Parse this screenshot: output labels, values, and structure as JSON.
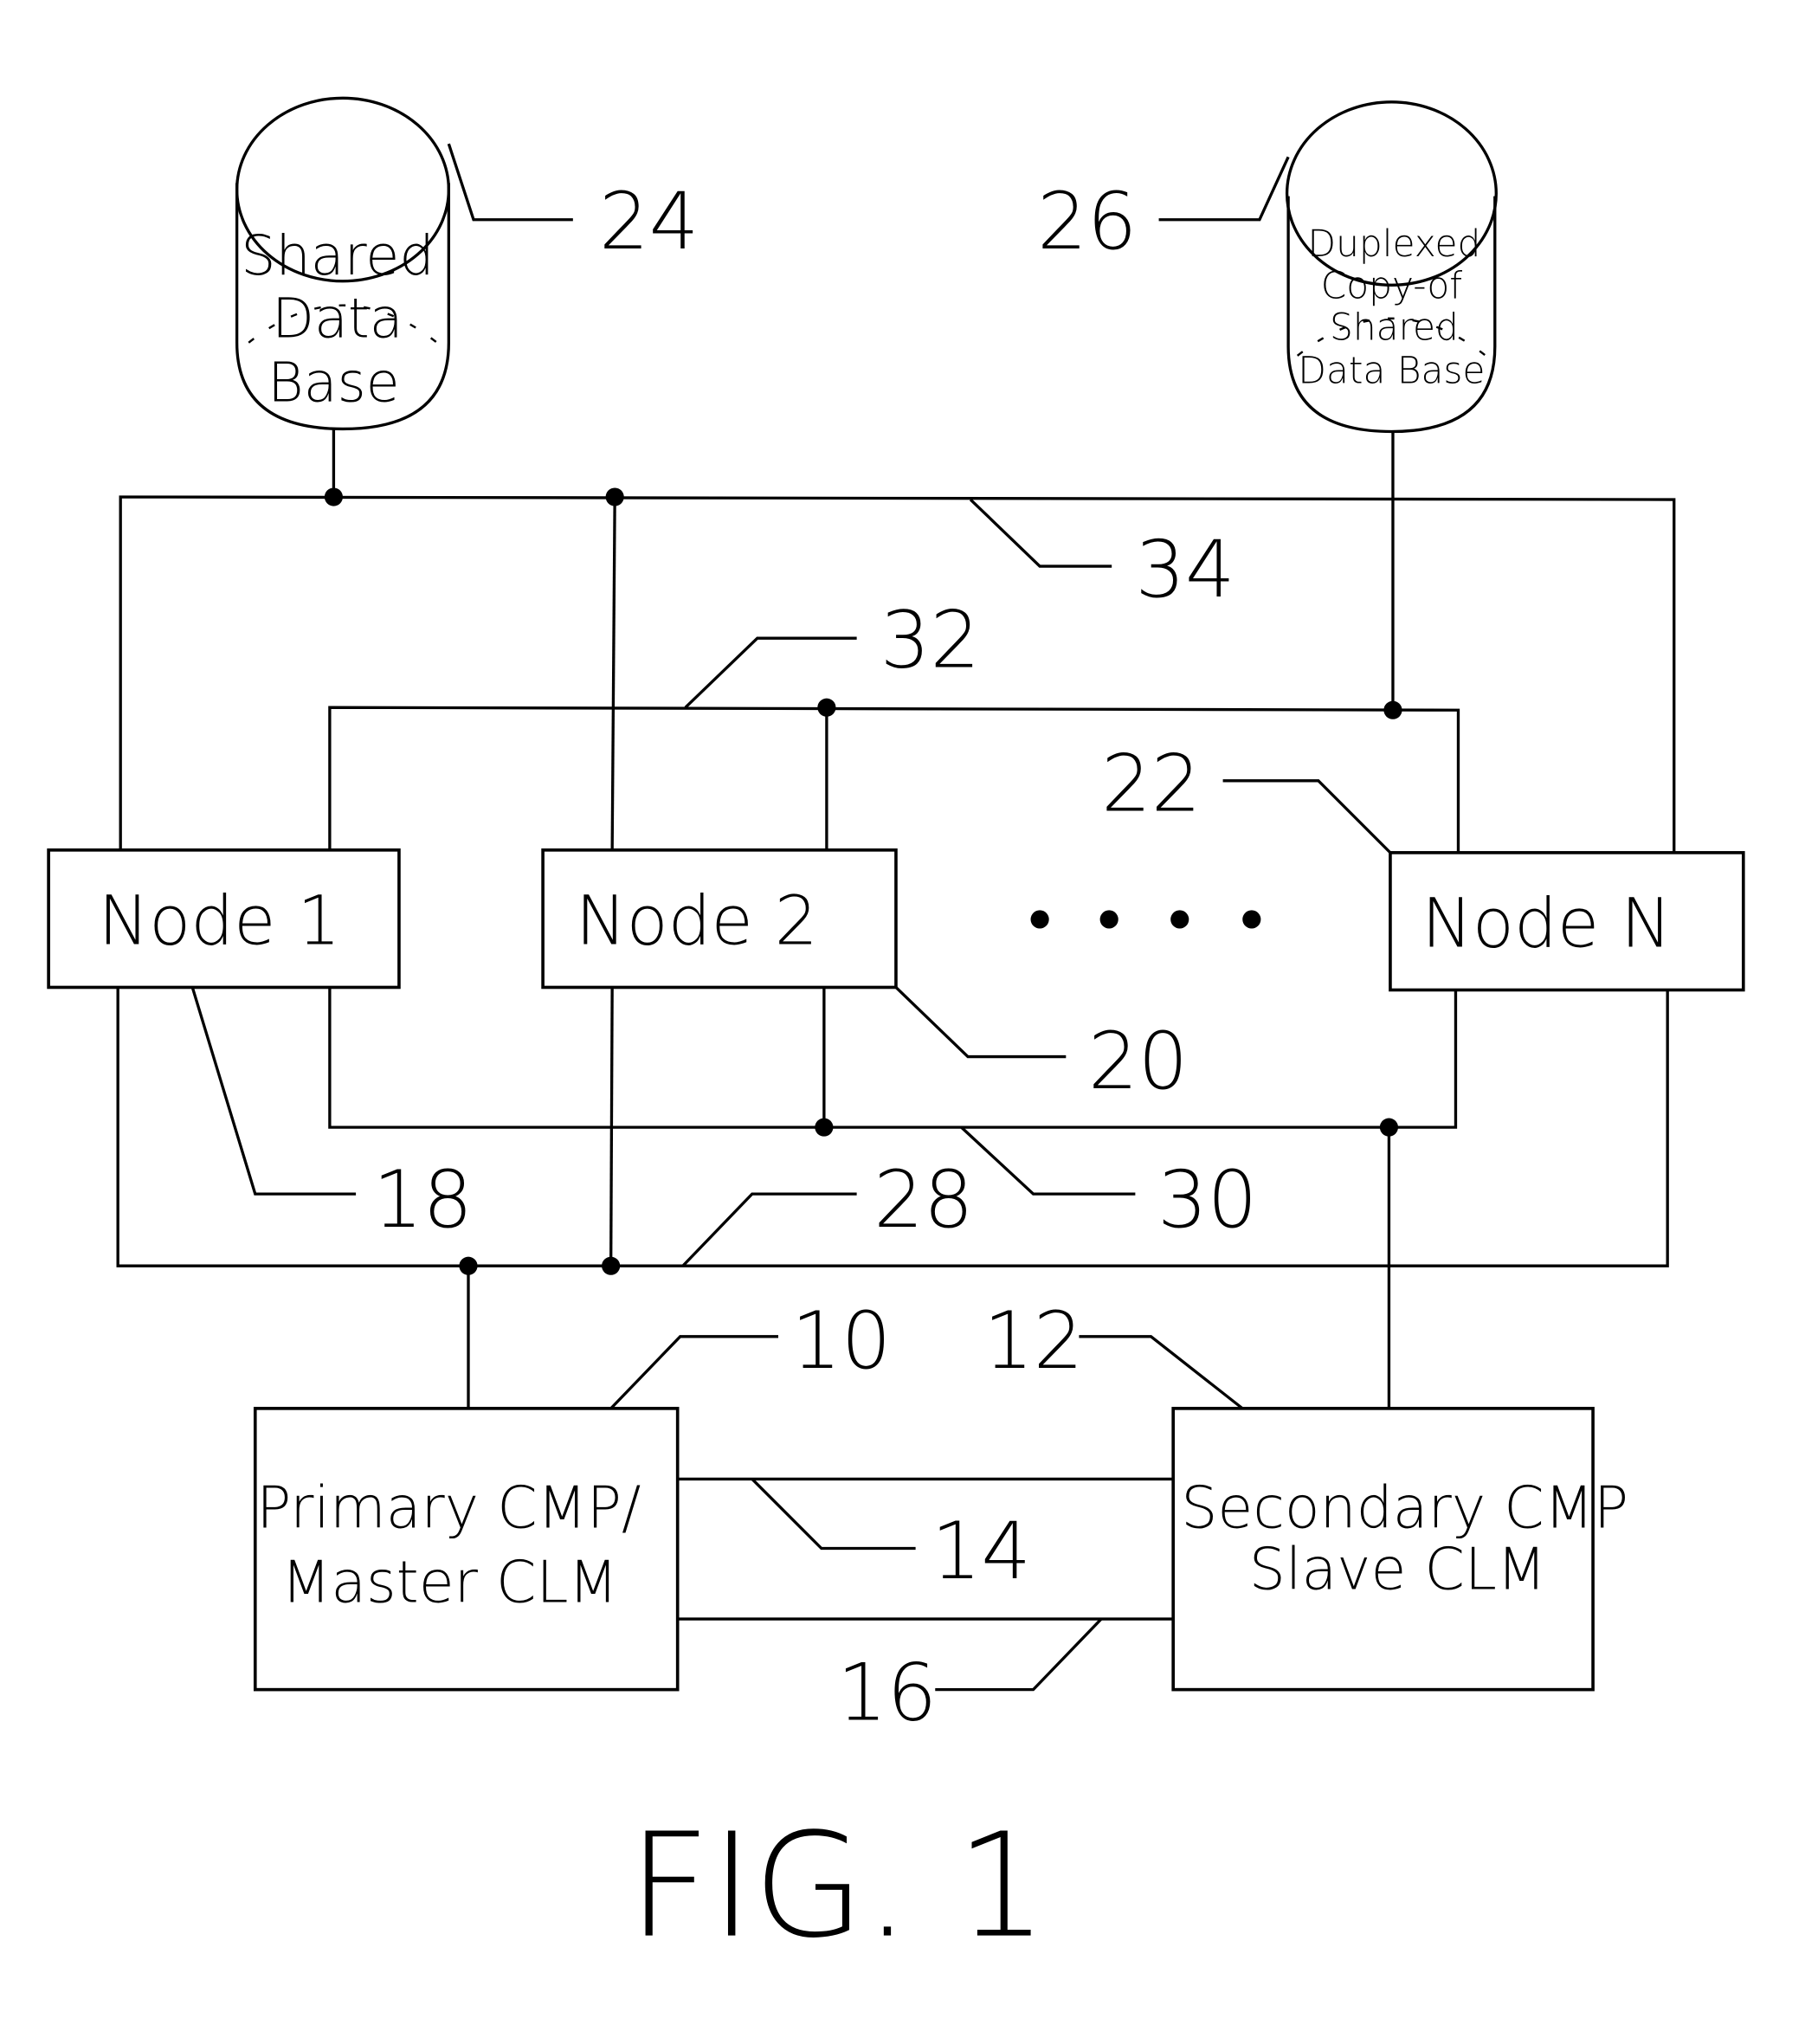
{
  "figure": {
    "title": "FIG. 1",
    "databases": [
      {
        "id": "24",
        "lines": [
          "Shared",
          "Data",
          "Base"
        ]
      },
      {
        "id": "26",
        "lines": [
          "Duplexed",
          "Copy-of",
          "Shared",
          "Data Base"
        ]
      }
    ],
    "nodes": [
      {
        "id": "18",
        "label": "Node 1"
      },
      {
        "id": "20",
        "label": "Node 2"
      },
      {
        "id": "22",
        "label": "Node N"
      }
    ],
    "ellipsis": "• • • •",
    "processors": [
      {
        "id": "10",
        "lines": [
          "Primary CMP/",
          "Master CLM"
        ]
      },
      {
        "id": "12",
        "lines": [
          "Secondary CMP",
          "Slave CLM"
        ]
      }
    ],
    "reference_numerals": {
      "n10": "10",
      "n12": "12",
      "n14": "14",
      "n16": "16",
      "n18": "18",
      "n20": "20",
      "n22": "22",
      "n24": "24",
      "n26": "26",
      "n28": "28",
      "n30": "30",
      "n32": "32",
      "n34": "34"
    }
  }
}
